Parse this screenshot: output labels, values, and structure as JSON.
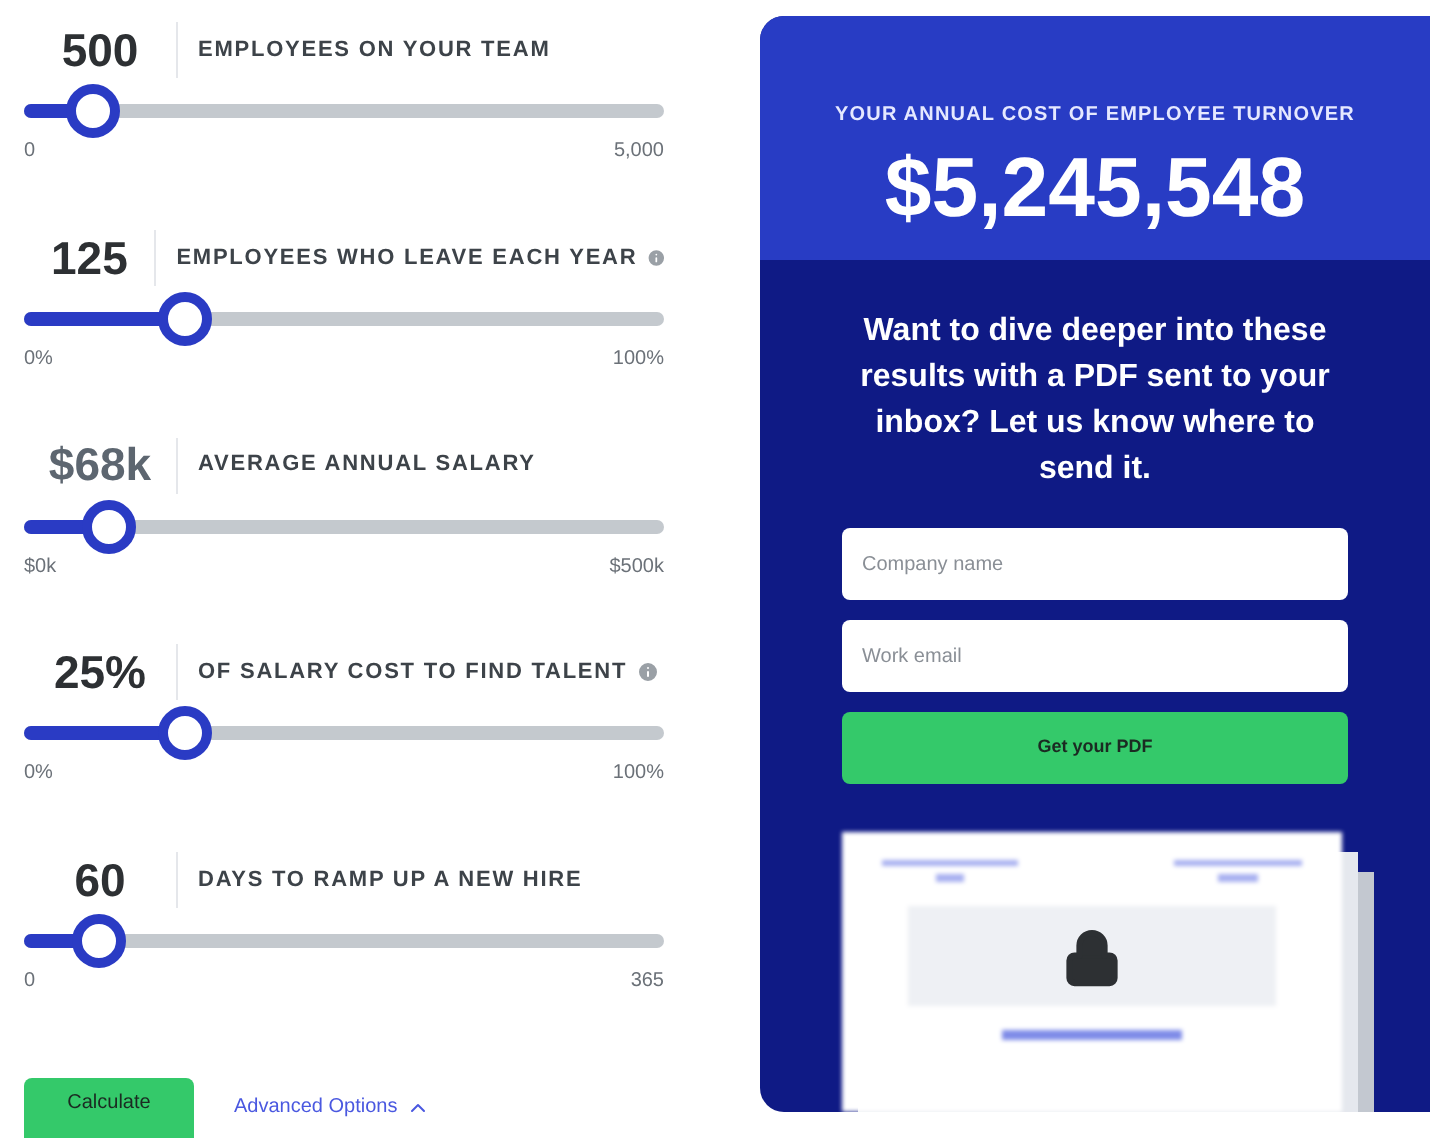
{
  "sliders": [
    {
      "value": "500",
      "label": "EMPLOYEES ON YOUR TEAM",
      "info": false,
      "value_muted": false,
      "level": 0.105,
      "min": "0",
      "max": "5,000"
    },
    {
      "value": "125",
      "label": "EMPLOYEES WHO LEAVE EACH YEAR",
      "info": true,
      "value_muted": false,
      "level": 0.25,
      "min": "0%",
      "max": "100%"
    },
    {
      "value": "$68k",
      "label": "AVERAGE ANNUAL SALARY",
      "info": false,
      "value_muted": true,
      "level": 0.13,
      "min": "$0k",
      "max": "$500k"
    },
    {
      "value": "25%",
      "label": "OF SALARY COST TO FIND TALENT",
      "info": true,
      "value_muted": false,
      "level": 0.25,
      "min": "0%",
      "max": "100%"
    },
    {
      "value": "60",
      "label": "DAYS TO RAMP UP A NEW HIRE",
      "info": false,
      "value_muted": false,
      "level": 0.115,
      "min": "0",
      "max": "365"
    }
  ],
  "calculate_button": "Calculate",
  "advanced_options": {
    "label": "Advanced Options",
    "expanded": true
  },
  "result": {
    "caption": "YOUR ANNUAL COST OF EMPLOYEE TURNOVER",
    "amount": "$5,245,548"
  },
  "report_form": {
    "heading": "Want to dive deeper into these results with a PDF sent to your inbox? Let us know where to send it.",
    "fields": [
      {
        "placeholder": "Company name"
      },
      {
        "placeholder": "Work email"
      }
    ],
    "button": "Get your PDF",
    "preview": {
      "locked": true
    }
  }
}
